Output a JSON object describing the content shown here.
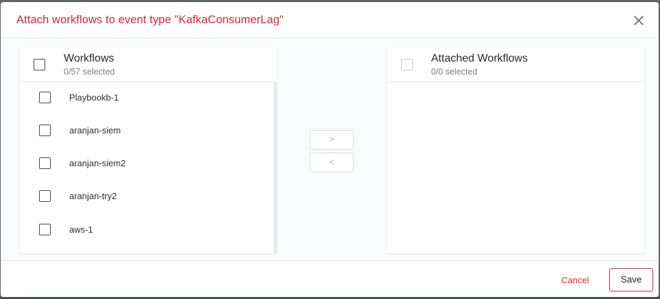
{
  "dialog": {
    "title": "Attach workflows to event type \"KafkaConsumerLag\""
  },
  "available": {
    "title": "Workflows",
    "selected_count": "0/57 selected",
    "items": [
      {
        "label": "Playbookb-1"
      },
      {
        "label": "aranjan-siem"
      },
      {
        "label": "aranjan-siem2"
      },
      {
        "label": "aranjan-try2"
      },
      {
        "label": "aws-1"
      }
    ]
  },
  "attached": {
    "title": "Attached Workflows",
    "selected_count": "0/0 selected"
  },
  "transfer": {
    "move_right_label": ">",
    "move_left_label": "<"
  },
  "footer": {
    "cancel_label": "Cancel",
    "save_label": "Save"
  },
  "colors": {
    "accent": "#d9262e",
    "backdrop": "#5f6266"
  }
}
